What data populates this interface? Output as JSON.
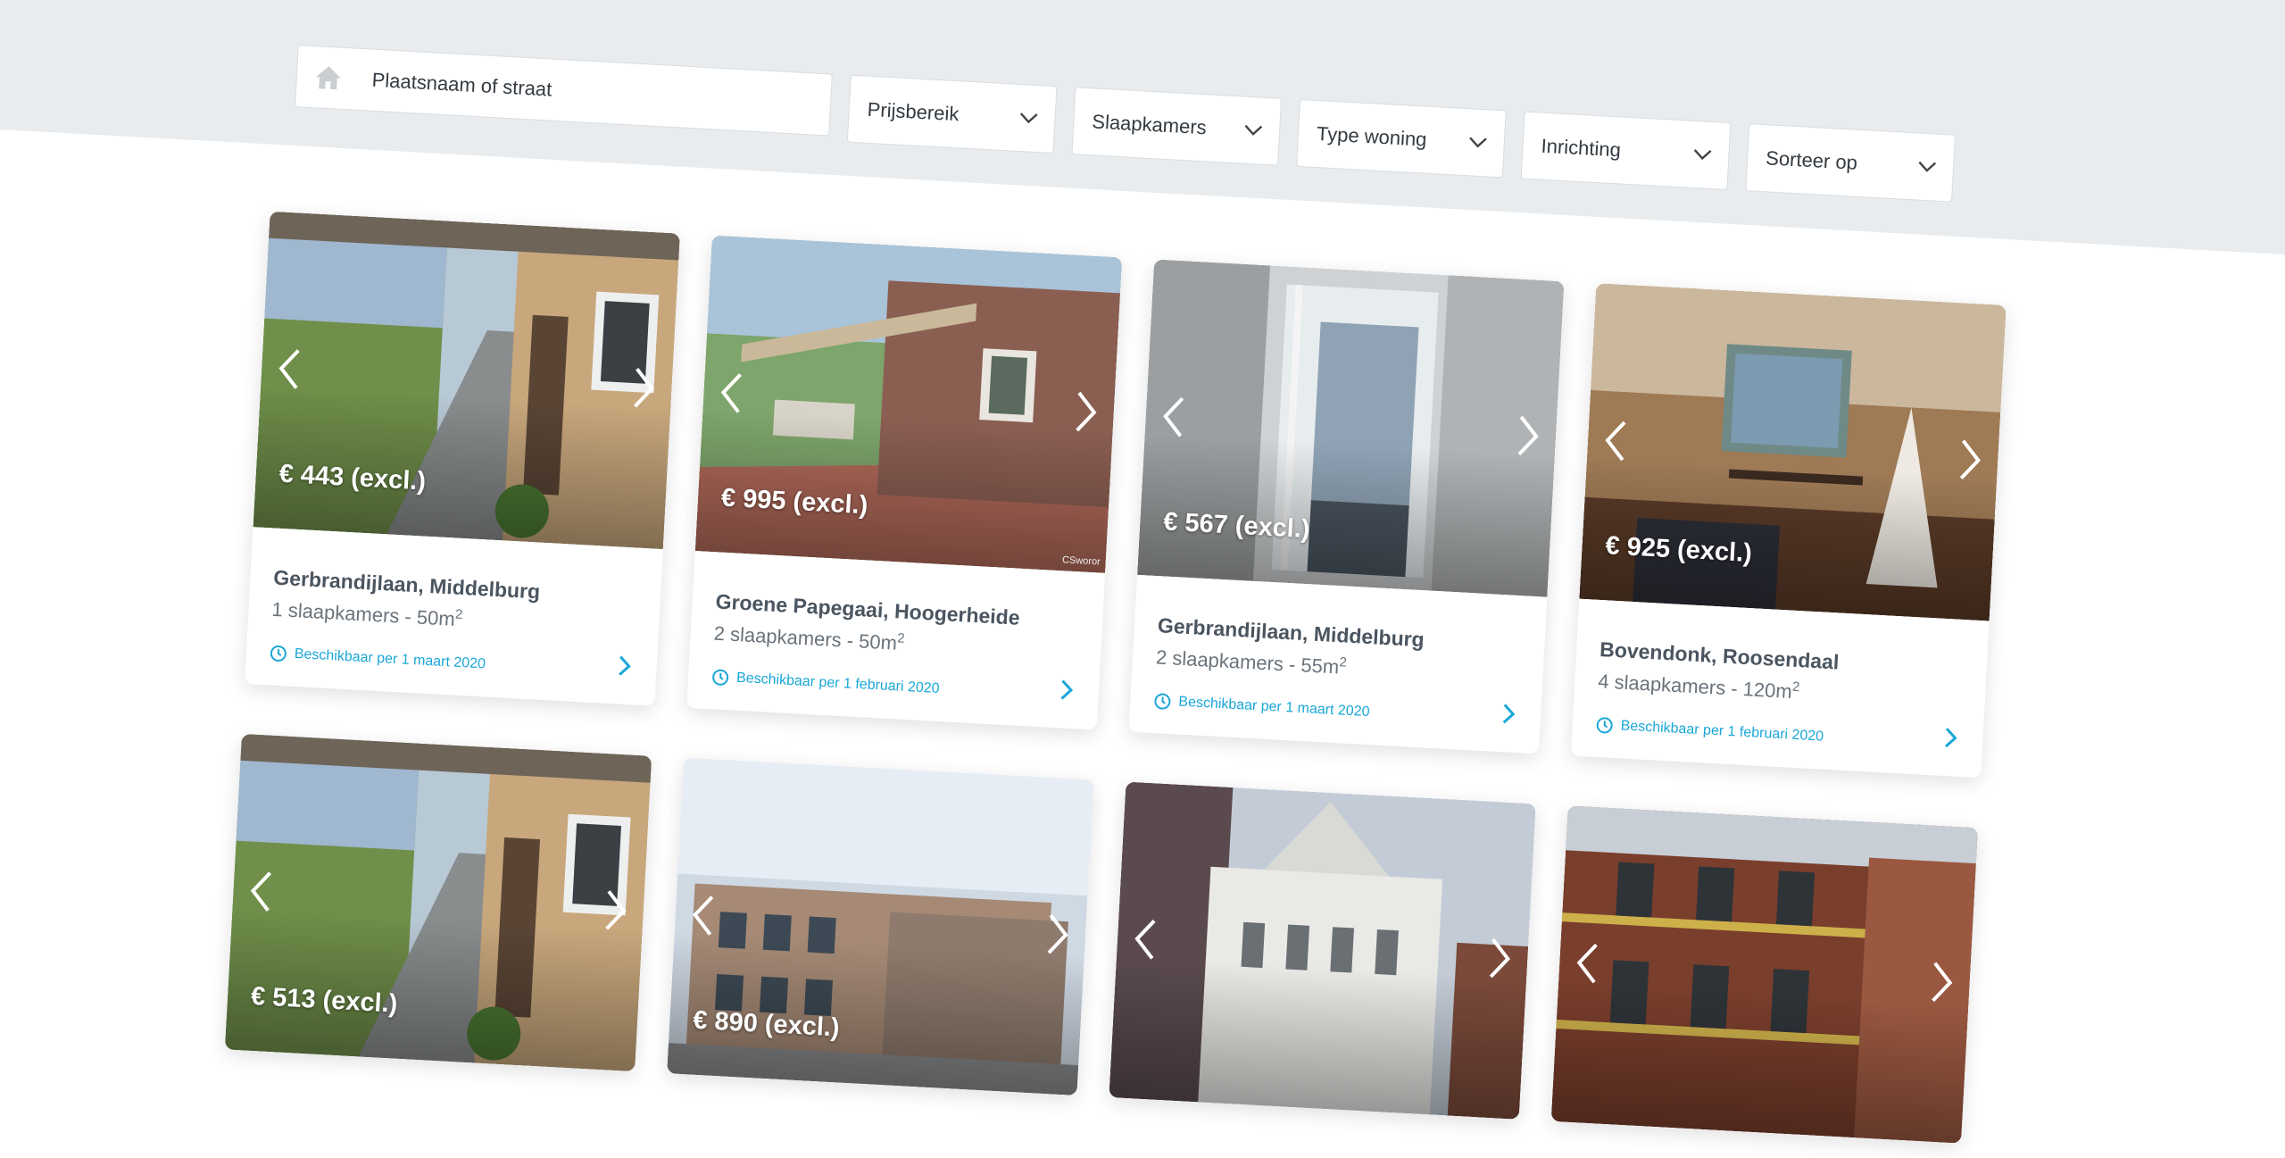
{
  "search": {
    "placeholder": "Plaatsnaam of straat"
  },
  "filters": [
    "Prijsbereik",
    "Slaapkamers",
    "Type woning",
    "Inrichting",
    "Sorteer op"
  ],
  "listings": [
    {
      "price": "€ 443 (excl.)",
      "address": "Gerbrandijlaan, Middelburg",
      "specs": "1 slaapkamers - 50m",
      "unit_power": "2",
      "availability": "Beschikbaar per 1 maart 2020",
      "scene": "corridor",
      "credit": ""
    },
    {
      "price": "€ 995 (excl.)",
      "address": "Groene Papegaai, Hoogerheide",
      "specs": "2 slaapkamers - 50m",
      "unit_power": "2",
      "availability": "Beschikbaar per 1 februari 2020",
      "scene": "patio",
      "credit": "CSworor"
    },
    {
      "price": "€ 567 (excl.)",
      "address": "Gerbrandijlaan, Middelburg",
      "specs": "2 slaapkamers - 55m",
      "unit_power": "2",
      "availability": "Beschikbaar per 1 maart 2020",
      "scene": "hallway",
      "credit": ""
    },
    {
      "price": "€ 925 (excl.)",
      "address": "Bovendonk, Roosendaal",
      "specs": "4 slaapkamers - 120m",
      "unit_power": "2",
      "availability": "Beschikbaar per 1 februari 2020",
      "scene": "dining",
      "credit": ""
    },
    {
      "price": "€ 513 (excl.)",
      "address": "",
      "specs": "",
      "unit_power": "",
      "availability": "",
      "scene": "corridor",
      "credit": ""
    },
    {
      "price": "€ 890 (excl.)",
      "address": "",
      "specs": "",
      "unit_power": "",
      "availability": "",
      "scene": "building",
      "credit": ""
    },
    {
      "price": "",
      "address": "",
      "specs": "",
      "unit_power": "",
      "availability": "",
      "scene": "church",
      "credit": ""
    },
    {
      "price": "",
      "address": "",
      "specs": "",
      "unit_power": "",
      "availability": "",
      "scene": "brick",
      "credit": ""
    }
  ],
  "colors": {
    "accent": "#1aa7d8",
    "band": "#e8ecef",
    "text_dark": "#4a5560"
  },
  "icons": {
    "search": "home-icon",
    "dropdown": "chevron-down-icon",
    "prev": "chevron-left-icon",
    "next": "chevron-right-icon",
    "availability": "clock-icon",
    "details": "chevron-right-icon"
  }
}
